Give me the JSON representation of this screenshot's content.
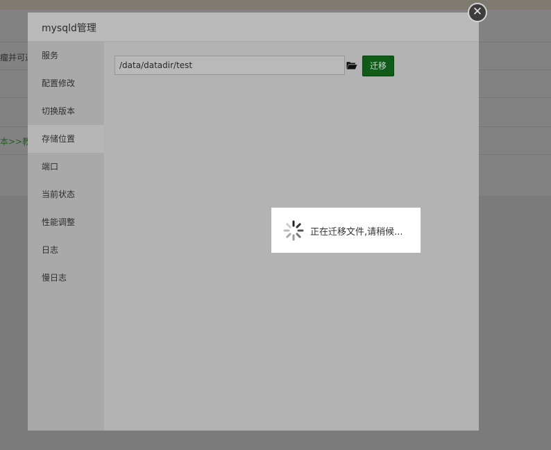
{
  "background": {
    "row_fragment_1": "瘤并可选",
    "row_fragment_2": "本>>教"
  },
  "dialog": {
    "title": "mysqld管理",
    "close_symbol": "✕"
  },
  "sidebar": {
    "items": [
      {
        "label": "服务"
      },
      {
        "label": "配置修改"
      },
      {
        "label": "切换版本"
      },
      {
        "label": "存储位置"
      },
      {
        "label": "端口"
      },
      {
        "label": "当前状态"
      },
      {
        "label": "性能调整"
      },
      {
        "label": "日志"
      },
      {
        "label": "慢日志"
      }
    ],
    "active_item": "存储位置"
  },
  "storage": {
    "path_value": "/data/datadir/test",
    "folder_icon": "folder-open-icon",
    "migrate_label": "迁移"
  },
  "loading": {
    "text": "正在迁移文件,请稍候..."
  },
  "colors": {
    "primary_button": "#0f5c18"
  }
}
